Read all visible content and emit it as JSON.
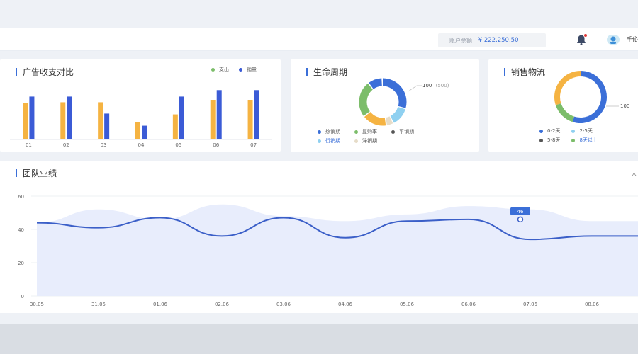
{
  "header": {
    "balance_label": "账户余额:",
    "balance_value": "¥ 222,250.50",
    "user_name": "千伈"
  },
  "ad_chart": {
    "title": "广告收支对比",
    "legend": [
      {
        "name": "支出",
        "color": "#7cbd6a"
      },
      {
        "name": "销量",
        "color": "#3b5bd6"
      }
    ]
  },
  "life_chart": {
    "title": "生命周期",
    "callout": "100",
    "callout_sub": "(500)",
    "legend": [
      {
        "name": "热销期",
        "color": "#3b6fd8"
      },
      {
        "name": "复购率",
        "color": "#7cbd6a"
      },
      {
        "name": "平销期",
        "color": "#555555"
      },
      {
        "name": "衍销期",
        "color": "#8fd0f0"
      },
      {
        "name": "滞销期",
        "color": "#e6dcc8"
      }
    ]
  },
  "logistics_chart": {
    "title": "销售物流",
    "callout": "100",
    "legend": [
      {
        "name": "0-2天",
        "color": "#3b6fd8"
      },
      {
        "name": "2-5天",
        "color": "#8fd0f0"
      },
      {
        "name": "5-8天",
        "color": "#555555"
      },
      {
        "name": "8天以上",
        "color": "#7cbd6a"
      }
    ]
  },
  "team_chart": {
    "title": "团队业绩",
    "corner_label": "本",
    "tooltip_value": "46"
  },
  "chart_data": [
    {
      "type": "bar",
      "title": "广告收支对比",
      "categories": [
        "01",
        "02",
        "03",
        "04",
        "05",
        "06",
        "07"
      ],
      "series": [
        {
          "name": "支出",
          "color": "#f5b342",
          "values": [
            45,
            46,
            46,
            21,
            31,
            49,
            49
          ]
        },
        {
          "name": "销量",
          "color": "#3b5bd6",
          "values": [
            53,
            53,
            32,
            17,
            53,
            61,
            61
          ]
        }
      ],
      "ylim": [
        0,
        70
      ]
    },
    {
      "type": "pie",
      "title": "生命周期",
      "slices": [
        {
          "name": "热销期",
          "value": 30,
          "color": "#3b6fd8"
        },
        {
          "name": "衍销期",
          "value": 13,
          "color": "#8fd0f0"
        },
        {
          "name": "滞销期",
          "value": 5,
          "color": "#e6dcc8"
        },
        {
          "name": "平销期",
          "value": 17,
          "color": "#f5b342"
        },
        {
          "name": "复购率",
          "value": 25,
          "color": "#7cbd6a"
        },
        {
          "name": "other",
          "value": 10,
          "color": "#3b6fd8"
        }
      ]
    },
    {
      "type": "pie",
      "title": "销售物流",
      "slices": [
        {
          "name": "0-2天",
          "value": 55,
          "color": "#3b6fd8"
        },
        {
          "name": "8天以上",
          "value": 15,
          "color": "#7cbd6a"
        },
        {
          "name": "5-8天",
          "value": 30,
          "color": "#f5b342"
        }
      ]
    },
    {
      "type": "area",
      "title": "团队业绩",
      "categories": [
        "30.05",
        "31.05",
        "01.06",
        "02.06",
        "03.06",
        "04.06",
        "05.06",
        "06.06",
        "07.06",
        "08.06"
      ],
      "y_ticks": [
        0,
        20,
        40,
        60
      ],
      "ylim": [
        0,
        60
      ],
      "series": [
        {
          "name": "line",
          "color": "#3b5fc8",
          "values": [
            44,
            41,
            47,
            36,
            47,
            35,
            45,
            46,
            34,
            36
          ]
        },
        {
          "name": "area",
          "color": "#e8edfc",
          "values": [
            44,
            52,
            46,
            55,
            48,
            45,
            49,
            54,
            52,
            45
          ]
        }
      ],
      "highlight_index": 8
    }
  ]
}
